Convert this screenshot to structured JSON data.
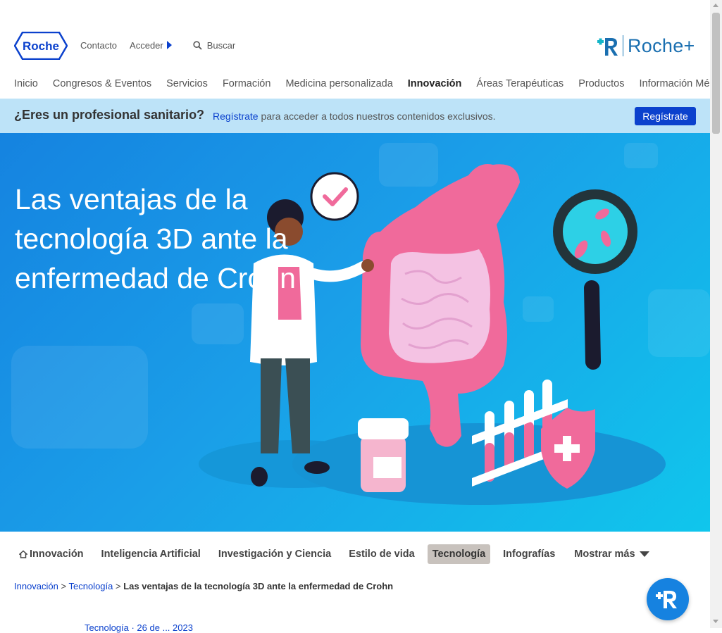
{
  "header": {
    "logo_text": "Roche",
    "contacto": "Contacto",
    "acceder": "Acceder",
    "search_label": "Buscar",
    "rocheplus_text": "Roche+"
  },
  "mainnav": {
    "items": [
      "Inicio",
      "Congresos & Eventos",
      "Servicios",
      "Formación",
      "Medicina personalizada",
      "Innovación",
      "Áreas Terapéuticas",
      "Productos",
      "Información Médica"
    ],
    "active": "Innovación"
  },
  "banner": {
    "question": "¿Eres un profesional sanitario?",
    "link": "Regístrate",
    "message": " para acceder a todos nuestros contenidos exclusivos.",
    "button": "Regístrate"
  },
  "hero": {
    "title": "Las ventajas de la tecnología 3D ante la enfermedad de Crohn"
  },
  "subnav": {
    "items": [
      "Innovación",
      "Inteligencia Artificial",
      "Investigación y Ciencia",
      "Estilo de vida",
      "Tecnología",
      "Infografías"
    ],
    "active": "Tecnología",
    "more": "Mostrar más"
  },
  "breadcrumb": {
    "level1": "Innovación",
    "level2": "Tecnología",
    "current": "Las ventajas de la tecnología 3D ante la enfermedad de Crohn",
    "separator": " > "
  },
  "article": {
    "date_partial": "Tecnología · 26 de ... 2023"
  },
  "colors": {
    "brand_blue": "#0b41cd",
    "banner_bg": "#bde3f8",
    "hero_blue": "#1a9ee8",
    "active_tab_bg": "#c8c2bd"
  },
  "icons": {
    "search": "search-icon",
    "home": "home-icon",
    "fab": "roche-plus-chat-icon"
  }
}
